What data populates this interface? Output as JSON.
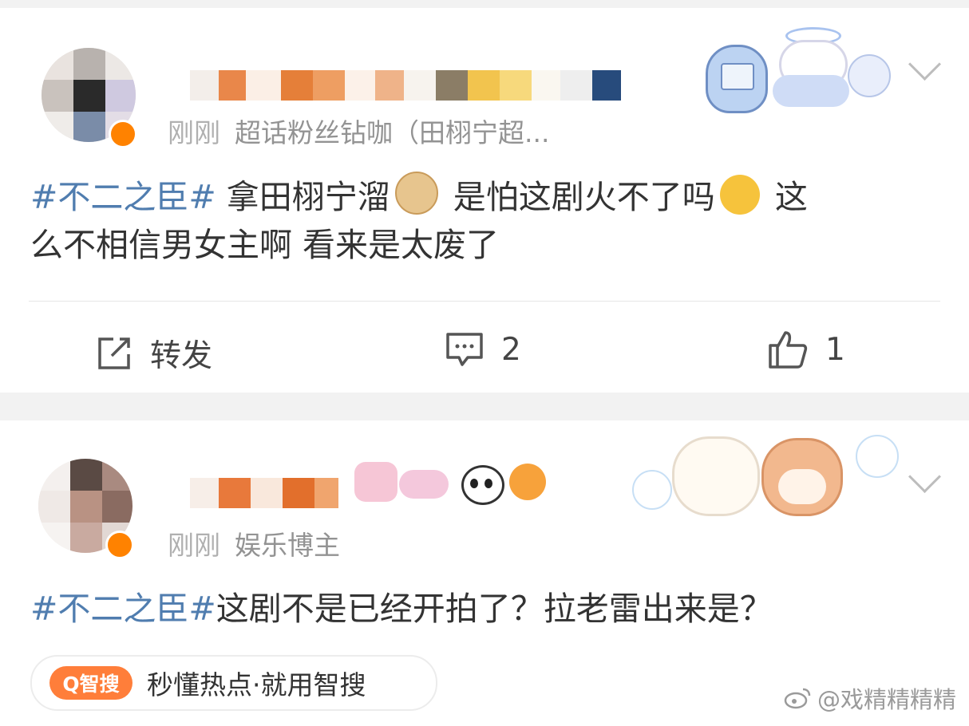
{
  "posts": [
    {
      "meta": {
        "time": "刚刚",
        "source": "超话粉丝钻咖（田栩宁超..."
      },
      "text": {
        "tag": "#不二之臣#",
        "part1": " 拿田栩宁溜",
        "part2": " 是怕这剧火不了吗",
        "part3": " 这",
        "line2": "么不相信男女主啊 看来是太废了"
      },
      "actions": {
        "repost_label": "转发",
        "comment_count": "2",
        "like_count": "1"
      }
    },
    {
      "meta": {
        "time": "刚刚",
        "source": "娱乐博主"
      },
      "text": {
        "tag": "#不二之臣#",
        "body": "这剧不是已经开拍了？拉老雷出来是？"
      }
    }
  ],
  "search_chip": {
    "logo": "Q智搜",
    "text": "秒懂热点·就用智搜"
  },
  "watermark": {
    "text": "@戏精精精精"
  },
  "icons": [
    "chevron-down-icon",
    "repost-icon",
    "comment-icon",
    "like-icon",
    "weibo-logo-icon"
  ],
  "colors": {
    "topic_link": "#507daf",
    "meta_text": "#939393",
    "brand_orange": "#ff7e3a"
  }
}
